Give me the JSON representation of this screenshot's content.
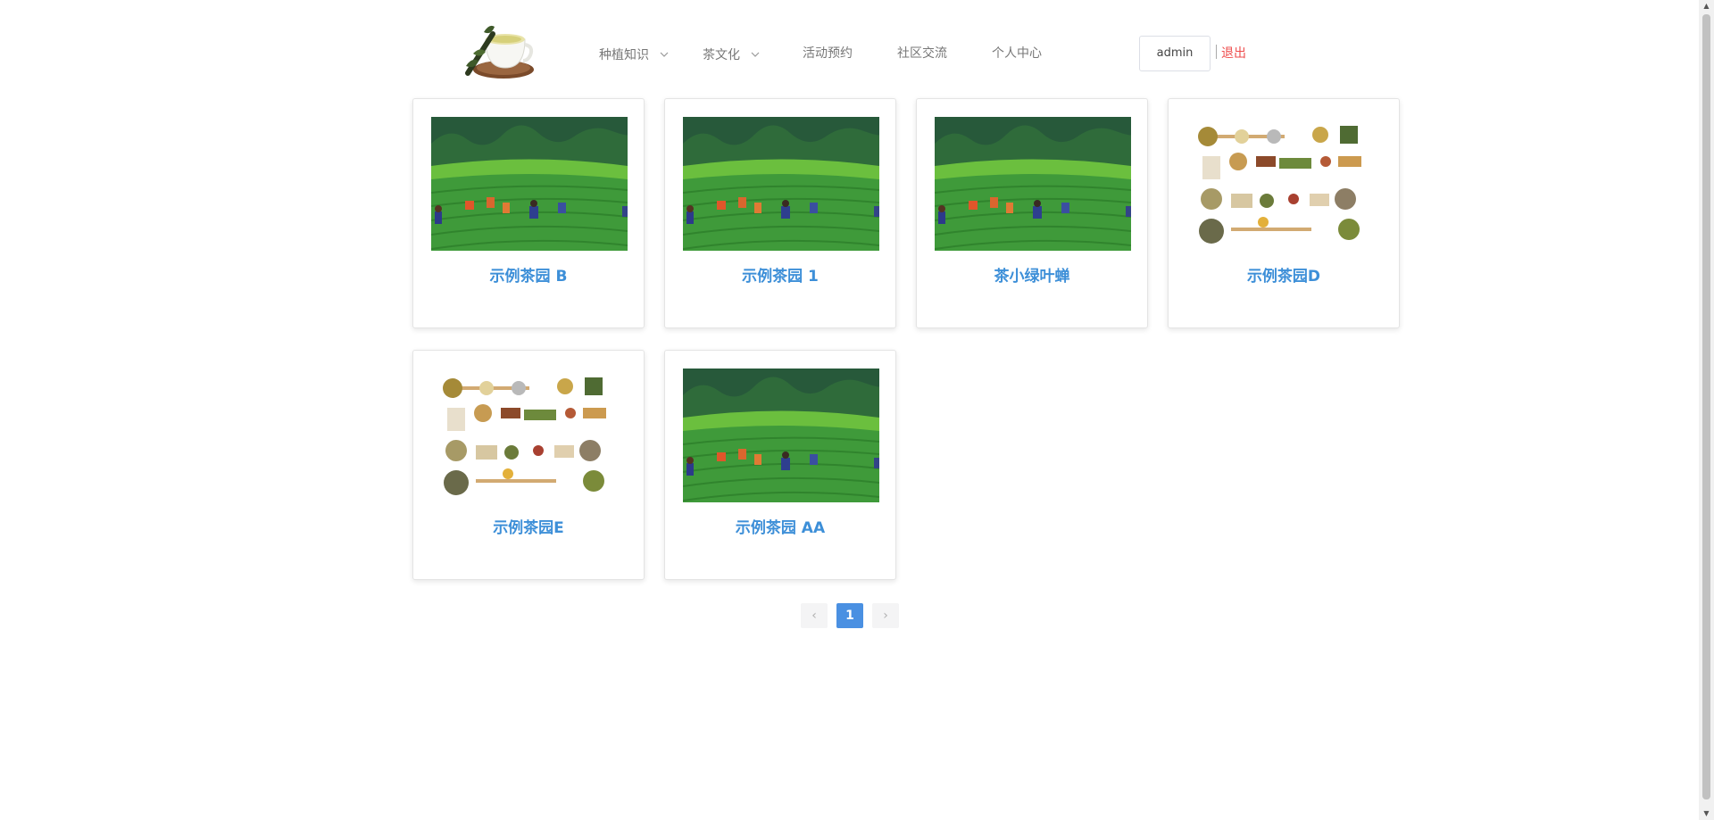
{
  "header": {
    "logo_icon": "tea-cup-logo",
    "nav": [
      {
        "label": "种植知识",
        "dropdown": true
      },
      {
        "label": "茶文化",
        "dropdown": true
      },
      {
        "label": "活动预约",
        "dropdown": false
      },
      {
        "label": "社区交流",
        "dropdown": false
      },
      {
        "label": "个人中心",
        "dropdown": false
      }
    ],
    "user": "admin",
    "logout": "退出"
  },
  "gardens": [
    {
      "title": "示例茶园 B",
      "image": "tea-field-photo"
    },
    {
      "title": "示例茶园 1",
      "image": "tea-field-photo"
    },
    {
      "title": "茶小绿叶蝉",
      "image": "tea-field-photo"
    },
    {
      "title": "示例茶园D",
      "image": "herbs-spices-photo"
    },
    {
      "title": "示例茶园E",
      "image": "herbs-spices-photo"
    },
    {
      "title": "示例茶园 AA",
      "image": "tea-field-photo"
    }
  ],
  "pagination": {
    "prev": "‹",
    "current": "1",
    "next": "›"
  },
  "colors": {
    "accent": "#4a90e2",
    "title": "#3d8fd8",
    "logout": "#ee4d4d"
  }
}
